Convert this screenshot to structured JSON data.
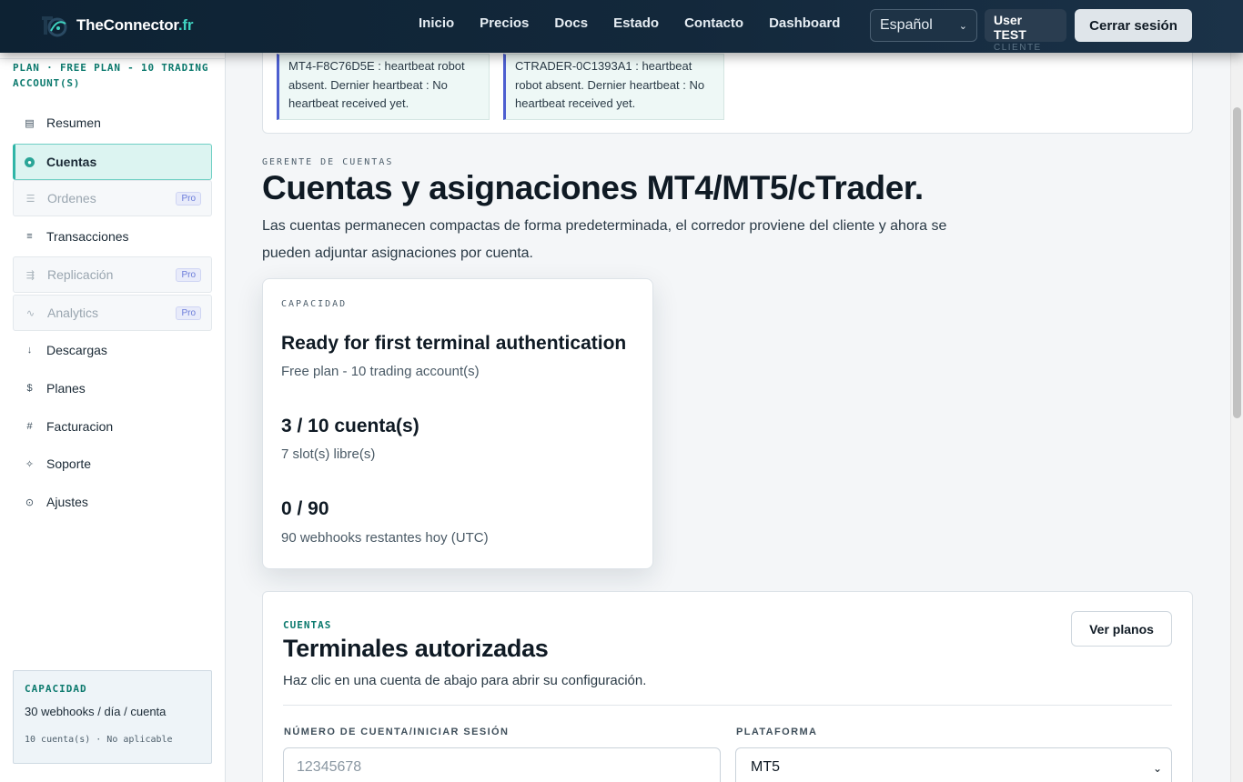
{
  "brand": {
    "name": "TheConnector",
    "tld": ".fr"
  },
  "nav": {
    "links": [
      "Inicio",
      "Precios",
      "Docs",
      "Estado",
      "Contacto",
      "Dashboard"
    ]
  },
  "language": {
    "selected": "Español"
  },
  "user": {
    "name": "User TEST",
    "role": "CLIENTE"
  },
  "logout_label": "Cerrar sesión",
  "sidebar": {
    "plan": "PLAN · FREE PLAN - 10 TRADING ACCOUNT(S)",
    "items": [
      {
        "label": "Resumen",
        "icon": "list-icon",
        "glyph": "▤"
      },
      {
        "label": "Cuentas",
        "icon": "accounts-icon",
        "glyph": "⏺"
      },
      {
        "label": "Ordenes",
        "icon": "orders-icon",
        "glyph": "☰",
        "badge": "Pro"
      },
      {
        "label": "Transacciones",
        "icon": "transactions-icon",
        "glyph": "≡"
      },
      {
        "label": "Replicación",
        "icon": "replication-icon",
        "glyph": "⇶",
        "badge": "Pro"
      },
      {
        "label": "Analytics",
        "icon": "analytics-icon",
        "glyph": "∿",
        "badge": "Pro"
      },
      {
        "label": "Descargas",
        "icon": "download-icon",
        "glyph": "↓"
      },
      {
        "label": "Planes",
        "icon": "dollar-icon",
        "glyph": "$"
      },
      {
        "label": "Facturacion",
        "icon": "hash-icon",
        "glyph": "#"
      },
      {
        "label": "Soporte",
        "icon": "support-icon",
        "glyph": "✧"
      },
      {
        "label": "Ajustes",
        "icon": "settings-icon",
        "glyph": "⊙"
      }
    ],
    "capacity": {
      "title": "CAPACIDAD",
      "line": "30 webhooks / día / cuenta",
      "sub": "10 cuenta(s) · No aplicable"
    }
  },
  "alerts": [
    "MT4-F8C76D5E : heartbeat robot absent. Dernier heartbeat : No heartbeat received yet.",
    "CTRADER-0C1393A1 : heartbeat robot absent. Dernier heartbeat : No heartbeat received yet."
  ],
  "header": {
    "eyebrow": "GERENTE DE CUENTAS",
    "title": "Cuentas y asignaciones MT4/MT5/cTrader.",
    "description": "Las cuentas permanecen compactas de forma predeterminada, el corredor proviene del cliente y ahora se pueden adjuntar asignaciones por cuenta."
  },
  "capacity_card": {
    "eyebrow": "CAPACIDAD",
    "status_title": "Ready for first terminal authentication",
    "status_sub": "Free plan - 10 trading account(s)",
    "accounts_value": "3 / 10 cuenta(s)",
    "accounts_sub": "7 slot(s) libre(s)",
    "webhooks_value": "0 / 90",
    "webhooks_sub": "90 webhooks restantes hoy (UTC)"
  },
  "accounts_section": {
    "eyebrow": "CUENTAS",
    "title": "Terminales autorizadas",
    "description": "Haz clic en una cuenta de abajo para abrir su configuración.",
    "plans_button": "Ver planos",
    "login_label": "NÚMERO DE CUENTA/INICIAR SESIÓN",
    "login_placeholder": "12345678",
    "platform_label": "PLATAFORMA",
    "platform_value": "MT5"
  }
}
